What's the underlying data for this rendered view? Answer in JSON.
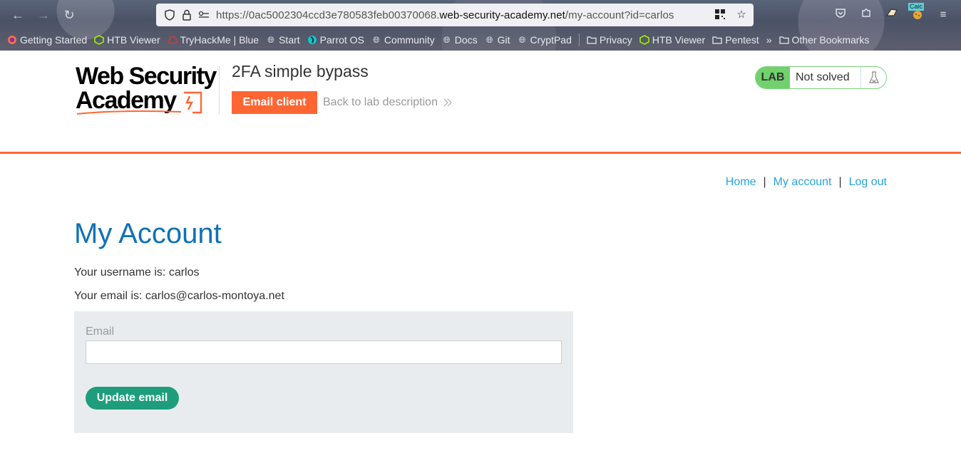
{
  "browser": {
    "url_prefix": "https://0ac5002304ccd3e780583feb00370068.",
    "url_domain": "web-security-academy.net",
    "url_path": "/my-account?id=carlos",
    "bookmarks": [
      {
        "label": "Getting Started",
        "icon": "firefox-icon"
      },
      {
        "label": "HTB Viewer",
        "icon": "cube-icon"
      },
      {
        "label": "TryHackMe | Blue",
        "icon": "cloud-icon"
      },
      {
        "label": "Start",
        "icon": "globe-icon"
      },
      {
        "label": "Parrot OS",
        "icon": "parrot-icon"
      },
      {
        "label": "Community",
        "icon": "globe-icon"
      },
      {
        "label": "Docs",
        "icon": "globe-icon"
      },
      {
        "label": "Git",
        "icon": "globe-icon"
      },
      {
        "label": "CryptPad",
        "icon": "globe-icon"
      },
      {
        "label": "Privacy",
        "icon": "folder-icon"
      },
      {
        "label": "HTB Viewer",
        "icon": "cube-icon"
      },
      {
        "label": "Pentest",
        "icon": "folder-icon"
      }
    ],
    "other_bookmarks": "Other Bookmarks",
    "extension_badge": "Caic"
  },
  "lab": {
    "logo_line1": "Web Security",
    "logo_line2": "Academy",
    "title": "2FA simple bypass",
    "email_client": "Email client",
    "back_link": "Back to lab description",
    "status_tag": "LAB",
    "status": "Not solved"
  },
  "nav": {
    "home": "Home",
    "my_account": "My account",
    "log_out": "Log out",
    "separator": "|"
  },
  "account": {
    "title": "My Account",
    "username_line": "Your username is: carlos",
    "email_line": "Your email is: carlos@carlos-montoya.net",
    "email_label": "Email",
    "email_value": "",
    "update_button": "Update email"
  },
  "colors": {
    "brand_orange": "#ff6633",
    "link_blue": "#29a3dc",
    "title_blue": "#0f72b6",
    "lab_green": "#70d16d",
    "button_teal": "#1e9d7c"
  }
}
